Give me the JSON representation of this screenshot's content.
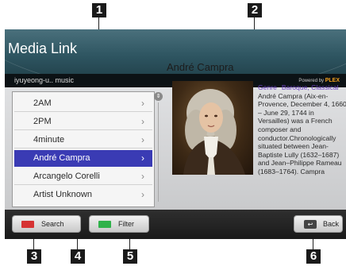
{
  "callouts": {
    "c1": "1",
    "c2": "2",
    "c3": "3",
    "c4": "4",
    "c5": "5",
    "c6": "6"
  },
  "header": {
    "title": "Media Link",
    "breadcrumb": "iyuyeong-u.. music",
    "powered_by": "Powered by",
    "brand": "PLEX"
  },
  "list": {
    "items": [
      {
        "label": "2AM",
        "chevron": "›"
      },
      {
        "label": "2PM",
        "chevron": "›"
      },
      {
        "label": "4minute",
        "chevron": "›"
      },
      {
        "label": "André Campra",
        "chevron": "›"
      },
      {
        "label": "Arcangelo Corelli",
        "chevron": "›"
      },
      {
        "label": "Artist Unknown",
        "chevron": "›"
      }
    ],
    "selected_index": 3,
    "scroll_icon": "⇕"
  },
  "detail": {
    "title": "André Campra",
    "genre_label": "Genre",
    "genre_value": "Baroque, Classical",
    "bio_lines": [
      "André Campra (Aix-en-",
      "Provence, December 4, 1660",
      "– June 29, 1744 in",
      "Versailles) was a French",
      "composer and",
      "conductor.Chronologically",
      "situated between Jean-",
      "Baptiste Lully (1632–1687)",
      "and Jean–Philippe Rameau",
      "(1683–1764). Campra"
    ]
  },
  "footer": {
    "search_label": "Search",
    "filter_label": "Filter",
    "back_label": "Back",
    "back_icon": "↩"
  },
  "colors": {
    "search_key": "#d63232",
    "filter_key": "#2fb24a",
    "selected_row": "#3a3bb4",
    "genre": "#6a3fbf"
  }
}
